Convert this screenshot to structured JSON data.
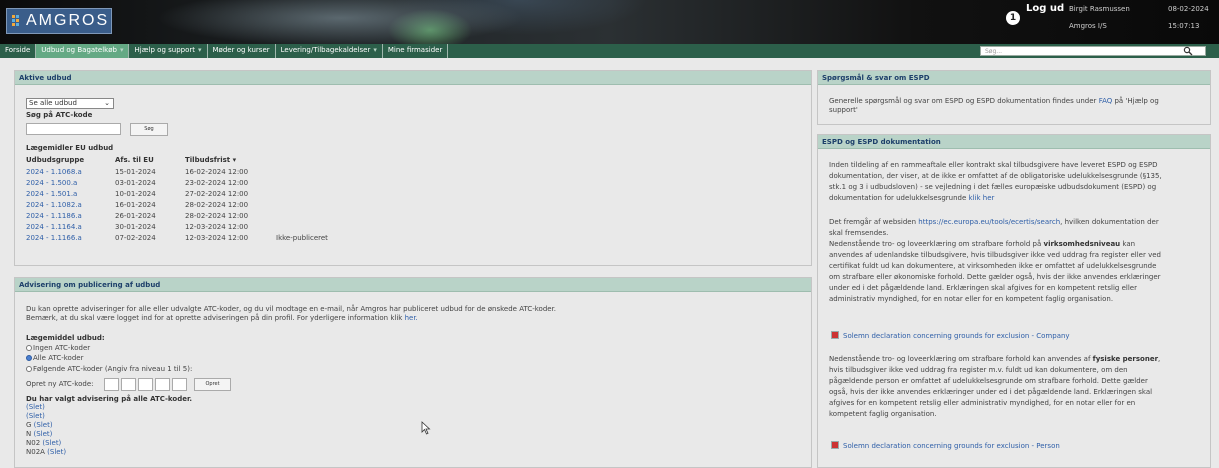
{
  "header": {
    "logo_text": "AMGROS",
    "logout": "Log ud",
    "user_name": "Birgit Rasmussen",
    "org_name": "Amgros I/S",
    "date": "08-02-2024",
    "time": "15:07:13"
  },
  "nav": {
    "items": [
      {
        "label": "Forside",
        "chev": ""
      },
      {
        "label": "Udbud og Bagatelkøb",
        "chev": "▾"
      },
      {
        "label": "Hjælp og support",
        "chev": "▾"
      },
      {
        "label": "Møder og kurser",
        "chev": ""
      },
      {
        "label": "Levering/Tilbagekaldelser",
        "chev": "▾"
      },
      {
        "label": "Mine firmasider",
        "chev": ""
      }
    ],
    "search_placeholder": "Søg..."
  },
  "aktive": {
    "title": "Aktive udbud",
    "select_value": "Se alle udbud",
    "atc_label": "Søg på ATC-kode",
    "search_button": "Søg",
    "section": "Lægemidler EU udbud",
    "headers": {
      "gruppe": "Udbudsgruppe",
      "afs": "Afs. til EU",
      "frist": "Tilbudsfrist ▾"
    },
    "rows": [
      {
        "gruppe": "2024 - 1.1068.a",
        "afs": "15-01-2024",
        "frist": "16-02-2024 12:00",
        "note": ""
      },
      {
        "gruppe": "2024 - 1.500.a",
        "afs": "03-01-2024",
        "frist": "23-02-2024 12:00",
        "note": ""
      },
      {
        "gruppe": "2024 - 1.501.a",
        "afs": "10-01-2024",
        "frist": "27-02-2024 12:00",
        "note": ""
      },
      {
        "gruppe": "2024 - 1.1082.a",
        "afs": "16-01-2024",
        "frist": "28-02-2024 12:00",
        "note": ""
      },
      {
        "gruppe": "2024 - 1.1186.a",
        "afs": "26-01-2024",
        "frist": "28-02-2024 12:00",
        "note": ""
      },
      {
        "gruppe": "2024 - 1.1164.a",
        "afs": "30-01-2024",
        "frist": "12-03-2024 12:00",
        "note": ""
      },
      {
        "gruppe": "2024 - 1.1166.a",
        "afs": "07-02-2024",
        "frist": "12-03-2024 12:00",
        "note": "Ikke-publiceret"
      }
    ]
  },
  "advis": {
    "title": "Advisering om publicering af udbud",
    "intro1": "Du kan oprette adviseringer for alle eller udvalgte ATC-koder, og du vil modtage en e-mail, når Amgros har publiceret udbud for de ønskede ATC-koder.",
    "intro2": "Bemærk, at du skal være logget ind for at oprette adviseringen på din profil. For yderligere information klik",
    "intro_link": "her.",
    "laeg_label": "Lægemiddel udbud:",
    "radio1": "Ingen ATC-koder",
    "radio2": "Alle ATC-koder",
    "radio3": "Følgende ATC-koder (Angiv fra niveau 1 til 5):",
    "opret_label": "Opret ny ATC-kode:",
    "opret_button": "Opret",
    "valgt": "Du har valgt advisering på alle ATC-koder.",
    "list": [
      {
        "code": "",
        "link": "(Slet)"
      },
      {
        "code": "",
        "link": "(Slet)"
      },
      {
        "code": "G",
        "link": "(Slet)"
      },
      {
        "code": "N",
        "link": "(Slet)"
      },
      {
        "code": "N02",
        "link": "(Slet)"
      },
      {
        "code": "N02A",
        "link": "(Slet)"
      }
    ]
  },
  "spor": {
    "title": "Spørgsmål & svar om ESPD",
    "text1": "Generelle spørgsmål og svar om ESPD og ESPD dokumentation findes under",
    "link": "FAQ",
    "text2": "på 'Hjælp og",
    "text3": "support'"
  },
  "espd": {
    "title": "ESPD og ESPD dokumentation",
    "p1": [
      "Inden tildeling af en rammeaftale eller kontrakt skal tilbudsgivere have leveret ESPD og ESPD",
      "dokumentation, der viser, at de ikke er omfattet af de obligatoriske udelukkelsesgrunde (§135,",
      "stk.1 og 3 i udbudsloven) - se vejledning i det fælles europæiske udbudsdokument (ESPD) og",
      "dokumentation for udelukkelsesgrunde"
    ],
    "p1_link": "klik her",
    "p2_pre": "Det fremgår af websiden",
    "p2_link": "https://ec.europa.eu/tools/ecertis/search",
    "p2_post": ", hvilken dokumentation der",
    "p2_line2": "skal fremsendes.",
    "p3_pre": "Nedenstående tro- og loveerklæring om strafbare forhold på",
    "p3_bold": "virksomhedsniveau",
    "p3_post": "kan",
    "p3_lines": [
      "anvendes af udenlandske tilbudsgivere, hvis tilbudsgiver ikke ved uddrag fra register eller ved",
      "certifikat fuldt ud kan dokumentere, at virksomheden ikke er omfattet af udelukkelsesgrunde",
      "om strafbare eller økonomiske forhold. Dette gælder også, hvis der ikke anvendes erklæringer",
      "under ed i det pågældende land. Erklæringen skal afgives for en kompetent retslig eller",
      "administrativ myndighed, for en notar eller for en kompetent faglig organisation."
    ],
    "doc1": "Solemn declaration concerning grounds for exclusion - Company",
    "p4_pre": "Nedenstående tro- og loveerklæring om strafbare forhold kan anvendes af",
    "p4_bold": "fysiske personer",
    "p4_post": ",",
    "p4_lines": [
      "hvis tilbudsgiver ikke ved uddrag fra register m.v. fuldt ud kan dokumentere, om den",
      "pågældende person er omfattet af udelukkelsesgrunde om strafbare forhold. Dette gælder",
      "også, hvis der ikke anvendes erklæringer under ed i det pågældende land. Erklæringen skal",
      "afgives for en kompetent retslig eller administrativ myndighed, for en notar eller for en",
      "kompetent faglig organisation."
    ],
    "doc2": "Solemn declaration concerning grounds for exclusion - Person"
  }
}
